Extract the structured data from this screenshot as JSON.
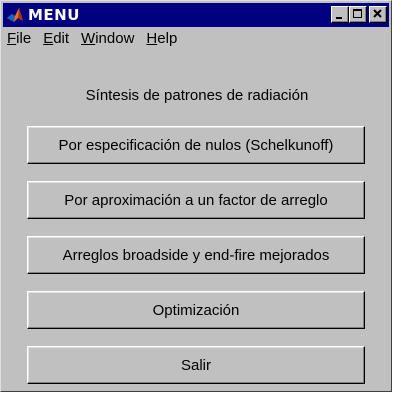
{
  "window": {
    "title": "MENU",
    "icon": "matlab-icon",
    "controls": [
      "minimize-icon",
      "maximize-icon",
      "close-icon"
    ]
  },
  "menubar": {
    "items": [
      {
        "mnemonic": "F",
        "rest": "ile"
      },
      {
        "mnemonic": "E",
        "rest": "dit"
      },
      {
        "mnemonic": "W",
        "rest": "indow"
      },
      {
        "mnemonic": "H",
        "rest": "elp"
      }
    ]
  },
  "main": {
    "heading": "Síntesis de patrones de radiación",
    "buttons": [
      "Por especificación de nulos (Schelkunoff)",
      "Por aproximación a un factor de arreglo",
      "Arreglos broadside y end-fire mejorados",
      "Optimización",
      "Salir"
    ]
  },
  "colors": {
    "titlebar": "#000080",
    "face": "#c0c0c0",
    "title_text": "#ffffff"
  }
}
